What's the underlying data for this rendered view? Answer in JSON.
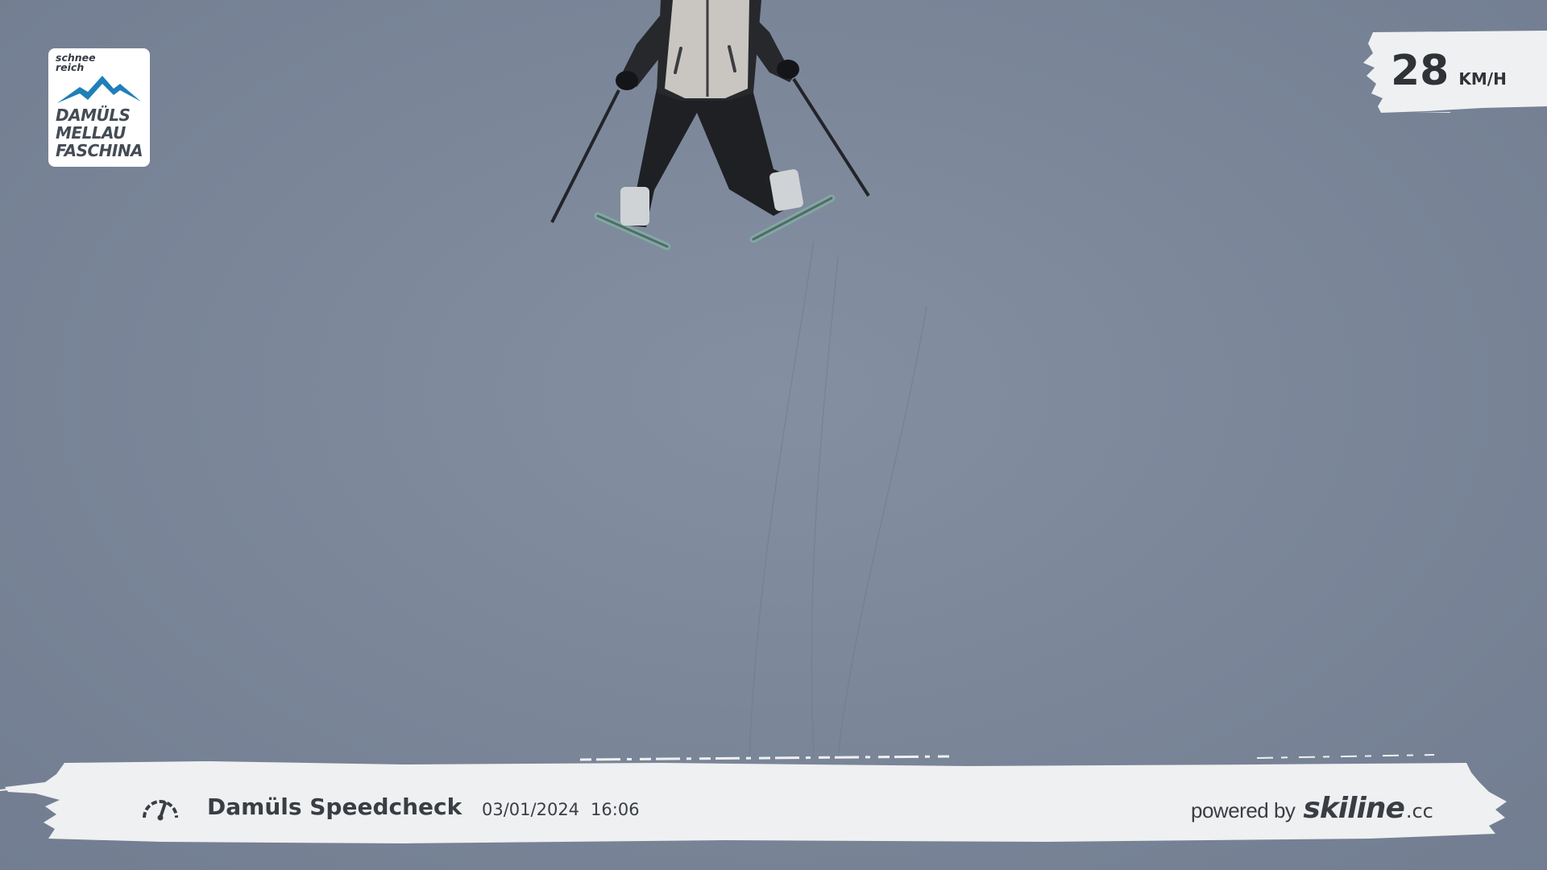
{
  "logo": {
    "tagline_line1": "schnee",
    "tagline_line2": "reich",
    "place_line1": "DAMÜLS",
    "place_line2": "MELLAU",
    "place_line3": "FASCHINA",
    "mountain_color": "#1f7fb8"
  },
  "speed": {
    "value": "28",
    "unit": "KM/H"
  },
  "footer": {
    "gauge_icon": "speedometer-icon",
    "title": "Damüls Speedcheck",
    "date": "03/01/2024",
    "time": "16:06",
    "powered_by": "powered by",
    "brand": "skiline",
    "brand_tld": ".cc"
  },
  "colors": {
    "snow": "#7c879a",
    "panel": "#eff0f1",
    "text": "#3a3e44",
    "jacket": "#2b2d31",
    "vest": "#c9c6c1",
    "ski": "#7fa9a1"
  }
}
